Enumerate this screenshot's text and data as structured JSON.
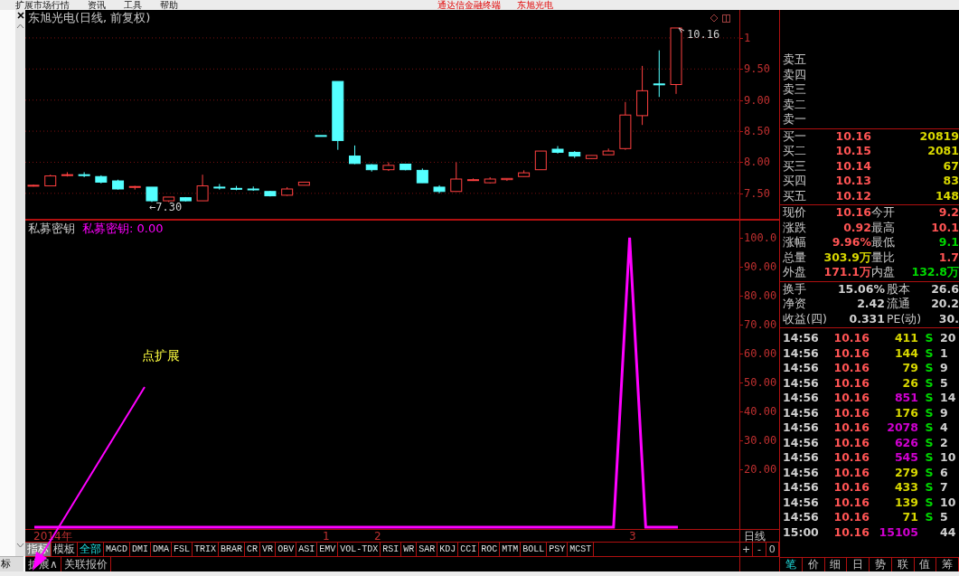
{
  "menu_bar": {
    "items": [
      "扩展市场行情",
      "资讯",
      "工具",
      "帮助"
    ],
    "app_title": "通达信金融终端",
    "stock_title": "东旭光电"
  },
  "gutter": {
    "tab_label": "标"
  },
  "price_chart": {
    "title": "东旭光电(日线, 前复权)",
    "low_label": "←7.30",
    "high_label": "10.16",
    "top_axis_label": "1",
    "chart_data": {
      "type": "candlestick",
      "categories": [
        null,
        null,
        null,
        null,
        null,
        null,
        null,
        null,
        null,
        null,
        null,
        null,
        null,
        null,
        null,
        null,
        null,
        null,
        null,
        null,
        null,
        null,
        null,
        null,
        null,
        null,
        null,
        null,
        null,
        null,
        null,
        null,
        null,
        null,
        null,
        null,
        null,
        null,
        null
      ],
      "ohlc": [
        [
          7.62,
          7.64,
          7.61,
          7.63
        ],
        [
          7.62,
          7.8,
          7.62,
          7.78
        ],
        [
          7.79,
          7.84,
          7.77,
          7.8
        ],
        [
          7.8,
          7.84,
          7.76,
          7.79
        ],
        [
          7.77,
          7.79,
          7.66,
          7.68
        ],
        [
          7.7,
          7.72,
          7.56,
          7.57
        ],
        [
          7.6,
          7.62,
          7.56,
          7.61
        ],
        [
          7.6,
          7.6,
          7.36,
          7.38
        ],
        [
          7.38,
          7.44,
          7.36,
          7.44
        ],
        [
          7.43,
          7.44,
          7.37,
          7.38
        ],
        [
          7.38,
          7.8,
          7.38,
          7.62
        ],
        [
          7.6,
          7.65,
          7.56,
          7.59
        ],
        [
          7.58,
          7.62,
          7.55,
          7.57
        ],
        [
          7.57,
          7.61,
          7.54,
          7.56
        ],
        [
          7.53,
          7.54,
          7.45,
          7.46
        ],
        [
          7.47,
          7.6,
          7.46,
          7.57
        ],
        [
          7.63,
          7.68,
          7.63,
          7.68
        ],
        [
          8.43,
          8.43,
          8.42,
          8.42
        ],
        [
          9.3,
          9.3,
          8.2,
          8.35
        ],
        [
          8.1,
          8.27,
          7.97,
          7.98
        ],
        [
          7.96,
          7.97,
          7.85,
          7.88
        ],
        [
          7.88,
          8.0,
          7.86,
          7.95
        ],
        [
          7.97,
          7.97,
          7.87,
          7.88
        ],
        [
          7.87,
          7.9,
          7.67,
          7.67
        ],
        [
          7.6,
          7.63,
          7.5,
          7.53
        ],
        [
          7.53,
          8.0,
          7.53,
          7.73
        ],
        [
          7.72,
          7.74,
          7.7,
          7.72
        ],
        [
          7.67,
          7.76,
          7.66,
          7.73
        ],
        [
          7.72,
          7.74,
          7.7,
          7.74
        ],
        [
          7.77,
          7.87,
          7.77,
          7.83
        ],
        [
          7.88,
          8.18,
          7.88,
          8.18
        ],
        [
          8.21,
          8.26,
          8.14,
          8.16
        ],
        [
          8.16,
          8.18,
          8.07,
          8.1
        ],
        [
          8.06,
          8.11,
          8.06,
          8.11
        ],
        [
          8.12,
          8.22,
          8.12,
          8.18
        ],
        [
          8.22,
          8.97,
          8.2,
          8.76
        ],
        [
          8.75,
          9.55,
          8.6,
          9.15
        ],
        [
          9.26,
          9.8,
          9.05,
          9.25
        ],
        [
          9.25,
          10.16,
          9.1,
          10.16
        ]
      ],
      "ylim": [
        7.09,
        10.45
      ],
      "grid": true,
      "yticks": [
        {
          "value": 9.5,
          "label": "9.50"
        },
        {
          "value": 9,
          "label": "9.00"
        },
        {
          "value": 8.5,
          "label": "8.50"
        },
        {
          "value": 8,
          "label": "8.00"
        },
        {
          "value": 7.5,
          "label": "7.50"
        }
      ]
    }
  },
  "indicator": {
    "value_label": "私募密钥: 0.00",
    "chart_data": {
      "type": "line",
      "categories": [
        null,
        null,
        null,
        null,
        null,
        null,
        null,
        null,
        null,
        null,
        null,
        null,
        null,
        null,
        null,
        null,
        null,
        null,
        null,
        null,
        null,
        null,
        null,
        null,
        null,
        null,
        null,
        null,
        null,
        null,
        null,
        null,
        null,
        null,
        null,
        null,
        null,
        null,
        null,
        null,
        null
      ],
      "series": [
        {
          "name": "私募密钥",
          "color": "#ff00ff",
          "values": [
            0,
            0,
            0,
            0,
            0,
            0,
            0,
            0,
            0,
            0,
            0,
            0,
            0,
            0,
            0,
            0,
            0,
            0,
            0,
            0,
            0,
            0,
            0,
            0,
            0,
            0,
            0,
            0,
            0,
            0,
            0,
            0,
            0,
            0,
            0,
            0,
            0,
            100,
            0,
            0,
            0
          ]
        }
      ],
      "ylim": [
        -0.6,
        105.9
      ],
      "yticks": [
        {
          "value": 100,
          "label": "100.0"
        },
        {
          "value": 90,
          "label": "90.00"
        },
        {
          "value": 80,
          "label": "80.00"
        },
        {
          "value": 70,
          "label": "70.00"
        },
        {
          "value": 60,
          "label": "60.00"
        },
        {
          "value": 50,
          "label": "50.00"
        },
        {
          "value": 40,
          "label": "40.00"
        },
        {
          "value": 30,
          "label": "30.00"
        },
        {
          "value": 20,
          "label": "20.00"
        }
      ]
    }
  },
  "annotation": {
    "text": "点扩展"
  },
  "time_axis": [
    "2014年",
    "1",
    "2",
    "3"
  ],
  "period": {
    "label": "日线",
    "buttons": [
      "+",
      "-",
      "0"
    ]
  },
  "indicator_bar": {
    "groups": [
      {
        "label": "指标",
        "selected": true
      },
      {
        "label": "模板",
        "selected": false
      }
    ],
    "tabs": [
      {
        "label": "全部",
        "selected": true
      },
      {
        "label": "MACD",
        "selected": false
      },
      {
        "label": "DMI",
        "selected": false
      },
      {
        "label": "DMA",
        "selected": false
      },
      {
        "label": "FSL",
        "selected": false
      },
      {
        "label": "TRIX",
        "selected": false
      },
      {
        "label": "BRAR",
        "selected": false
      },
      {
        "label": "CR",
        "selected": false
      },
      {
        "label": "VR",
        "selected": false
      },
      {
        "label": "OBV",
        "selected": false
      },
      {
        "label": "ASI",
        "selected": false
      },
      {
        "label": "EMV",
        "selected": false
      },
      {
        "label": "VOL-TDX",
        "selected": false
      },
      {
        "label": "RSI",
        "selected": false
      },
      {
        "label": "WR",
        "selected": false
      },
      {
        "label": "SAR",
        "selected": false
      },
      {
        "label": "KDJ",
        "selected": false
      },
      {
        "label": "CCI",
        "selected": false
      },
      {
        "label": "ROC",
        "selected": false
      },
      {
        "label": "MTM",
        "selected": false
      },
      {
        "label": "BOLL",
        "selected": false
      },
      {
        "label": "PSY",
        "selected": false
      },
      {
        "label": "MCST",
        "selected": false
      }
    ],
    "buttons": [
      "扩展∧",
      "关联报价"
    ]
  },
  "quote_panel": {
    "sell": [
      "卖五",
      "卖四",
      "卖三",
      "卖二",
      "卖一"
    ],
    "buy": [
      {
        "label": "买一",
        "price": "10.16",
        "volume": "20819"
      },
      {
        "label": "买二",
        "price": "10.15",
        "volume": "2081"
      },
      {
        "label": "买三",
        "price": "10.14",
        "volume": "67"
      },
      {
        "label": "买四",
        "price": "10.13",
        "volume": "83"
      },
      {
        "label": "买五",
        "price": "10.12",
        "volume": "148"
      }
    ],
    "stats": [
      {
        "label": "现价",
        "value": "10.16",
        "color": "#ff5454"
      },
      {
        "label": "今开",
        "value": "9.2",
        "color": "#ff5454"
      },
      {
        "label": "涨跌",
        "value": "0.92",
        "color": "#ff5454"
      },
      {
        "label": "最高",
        "value": "10.1",
        "color": "#ff5454"
      },
      {
        "label": "涨幅",
        "value": "9.96%",
        "color": "#ff5454"
      },
      {
        "label": "最低",
        "value": "9.1",
        "color": "#00d800"
      },
      {
        "label": "总量",
        "value": "303.9万",
        "color": "#d8d800"
      },
      {
        "label": "量比",
        "value": "1.7",
        "color": "#ff5454"
      },
      {
        "label": "外盘",
        "value": "171.1万",
        "color": "#ff5454"
      },
      {
        "label": "内盘",
        "value": "132.8万",
        "color": "#00d800"
      }
    ],
    "fundamentals": [
      {
        "label": "换手",
        "value": "15.06%"
      },
      {
        "label": "股本",
        "value": "26.6"
      },
      {
        "label": "净资",
        "value": "2.42"
      },
      {
        "label": "流通",
        "value": "20.2"
      },
      {
        "label": "收益(四)",
        "value": "0.331"
      },
      {
        "label": "PE(动)",
        "value": "30."
      }
    ],
    "ticks": [
      {
        "time": "14:56",
        "price": "10.16",
        "volume": "411",
        "color": "#d8d800",
        "side": "S",
        "extra": "20"
      },
      {
        "time": "14:56",
        "price": "10.16",
        "volume": "144",
        "color": "#d8d800",
        "side": "S",
        "extra": "1"
      },
      {
        "time": "14:56",
        "price": "10.16",
        "volume": "79",
        "color": "#d8d800",
        "side": "S",
        "extra": "9"
      },
      {
        "time": "14:56",
        "price": "10.16",
        "volume": "26",
        "color": "#d8d800",
        "side": "S",
        "extra": "5"
      },
      {
        "time": "14:56",
        "price": "10.16",
        "volume": "851",
        "color": "#d000d0",
        "side": "S",
        "extra": "14"
      },
      {
        "time": "14:56",
        "price": "10.16",
        "volume": "176",
        "color": "#d8d800",
        "side": "S",
        "extra": "9"
      },
      {
        "time": "14:56",
        "price": "10.16",
        "volume": "2078",
        "color": "#d000d0",
        "side": "S",
        "extra": "4"
      },
      {
        "time": "14:56",
        "price": "10.16",
        "volume": "626",
        "color": "#d000d0",
        "side": "S",
        "extra": "2"
      },
      {
        "time": "14:56",
        "price": "10.16",
        "volume": "545",
        "color": "#d000d0",
        "side": "S",
        "extra": "10"
      },
      {
        "time": "14:56",
        "price": "10.16",
        "volume": "279",
        "color": "#d8d800",
        "side": "S",
        "extra": "6"
      },
      {
        "time": "14:56",
        "price": "10.16",
        "volume": "433",
        "color": "#d8d800",
        "side": "S",
        "extra": "7"
      },
      {
        "time": "14:56",
        "price": "10.16",
        "volume": "139",
        "color": "#d8d800",
        "side": "S",
        "extra": "10"
      },
      {
        "time": "14:56",
        "price": "10.16",
        "volume": "71",
        "color": "#d8d800",
        "side": "S",
        "extra": "5"
      },
      {
        "time": "15:00",
        "price": "10.16",
        "volume": "15105",
        "color": "#d000d0",
        "extra": "44"
      }
    ],
    "tabs": [
      {
        "label": "笔",
        "selected": true
      },
      {
        "label": "价",
        "selected": false
      },
      {
        "label": "细",
        "selected": false
      },
      {
        "label": "日",
        "selected": false
      },
      {
        "label": "势",
        "selected": false
      },
      {
        "label": "联",
        "selected": false
      },
      {
        "label": "值",
        "selected": false
      },
      {
        "label": "筹",
        "selected": false
      }
    ]
  }
}
